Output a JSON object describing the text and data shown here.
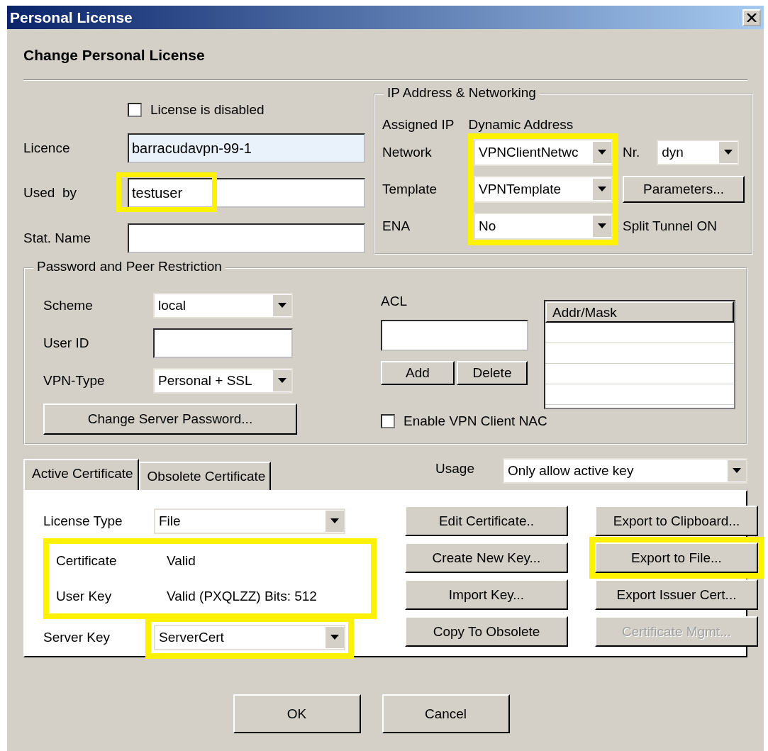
{
  "window": {
    "title": "Personal License"
  },
  "heading": "Change Personal License",
  "license": {
    "disabled_checkbox": {
      "label": "License is disabled",
      "checked": false
    },
    "fields": [
      {
        "label": "Licence",
        "value": "barracudavpn-99-1",
        "readonly": true,
        "highlighted": false
      },
      {
        "label": "Used  by",
        "value": "testuser",
        "readonly": false,
        "highlighted": true
      },
      {
        "label": "Stat. Name",
        "readonly": false,
        "highlighted": false
      }
    ]
  },
  "ip_networking": {
    "title": "IP Address & Networking",
    "assigned_label": "Assigned IP",
    "assigned_value": "Dynamic Address",
    "highlighted": true,
    "rows": [
      {
        "label": "Network",
        "value": "VPNClientNetwc"
      },
      {
        "label": "Template",
        "value": "VPNTemplate"
      },
      {
        "label": "ENA",
        "value": "No"
      }
    ],
    "nr": {
      "label": "Nr.",
      "value": "dyn"
    },
    "parameters_button": "Parameters...",
    "split_tunnel": "Split Tunnel ON"
  },
  "password": {
    "title": "Password and Peer Restriction",
    "scheme": {
      "label": "Scheme",
      "value": "local"
    },
    "user_id": {
      "label": "User ID"
    },
    "vpn_type": {
      "label": "VPN-Type",
      "value": "Personal + SSL"
    },
    "change_password_button": "Change Server Password...",
    "acl": {
      "label": "ACL",
      "add_button": "Add",
      "delete_button": "Delete",
      "list_header": "Addr/Mask"
    },
    "nac_checkbox": {
      "label": "Enable VPN Client NAC",
      "checked": false
    }
  },
  "tabs": [
    {
      "label": "Active Certificate",
      "selected": true
    },
    {
      "label": "Obsolete Certificate",
      "selected": false
    }
  ],
  "usage": {
    "label": "Usage",
    "value": "Only allow active key"
  },
  "certificate": {
    "license_type": {
      "label": "License Type",
      "value": "File"
    },
    "status_highlighted": true,
    "status": [
      {
        "label": "Certificate",
        "value": "Valid"
      },
      {
        "label": "User Key",
        "value": "Valid (PXQLZZ) Bits: 512"
      }
    ],
    "server_key": {
      "label": "Server Key",
      "value": "ServerCert",
      "highlighted": true
    },
    "button_columns": [
      [
        {
          "label": "Edit Certificate..",
          "disabled": false,
          "highlighted": false
        },
        {
          "label": "Create New Key...",
          "disabled": false,
          "highlighted": false
        },
        {
          "label": "Import Key...",
          "disabled": false,
          "highlighted": false
        },
        {
          "label": "Copy To Obsolete",
          "disabled": false,
          "highlighted": false
        }
      ],
      [
        {
          "label": "Export to Clipboard...",
          "disabled": false,
          "highlighted": false
        },
        {
          "label": "Export to File...",
          "disabled": false,
          "highlighted": true
        },
        {
          "label": "Export Issuer Cert...",
          "disabled": false,
          "highlighted": false
        },
        {
          "label": "Certificate Mgmt...",
          "disabled": true,
          "highlighted": false
        }
      ]
    ]
  },
  "footer_buttons": [
    "OK",
    "Cancel"
  ]
}
